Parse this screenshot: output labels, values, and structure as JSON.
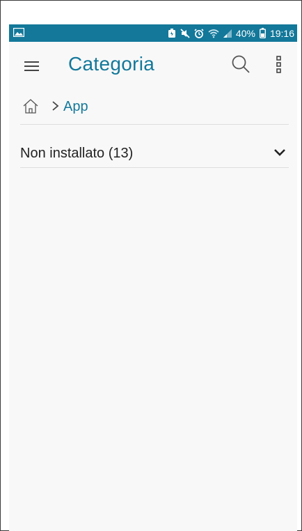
{
  "status_bar": {
    "battery_percent": "40%",
    "time": "19:16",
    "icons": [
      "image-icon",
      "battery-saver-icon",
      "mute-icon",
      "alarm-icon",
      "wifi-icon",
      "signal-icon",
      "battery-icon"
    ]
  },
  "app_bar": {
    "title": "Categoria",
    "icons": [
      "menu-icon",
      "search-icon",
      "more-vert-icon"
    ]
  },
  "breadcrumb": {
    "home_icon": "home-icon",
    "current": "App"
  },
  "section": {
    "label": "Non installato (13)",
    "icon": "chevron-down-icon"
  },
  "colors": {
    "accent": "#13789a",
    "status_bar": "#13789a",
    "background": "#f8f8f8",
    "divider": "#dedede",
    "text": "#222222"
  }
}
